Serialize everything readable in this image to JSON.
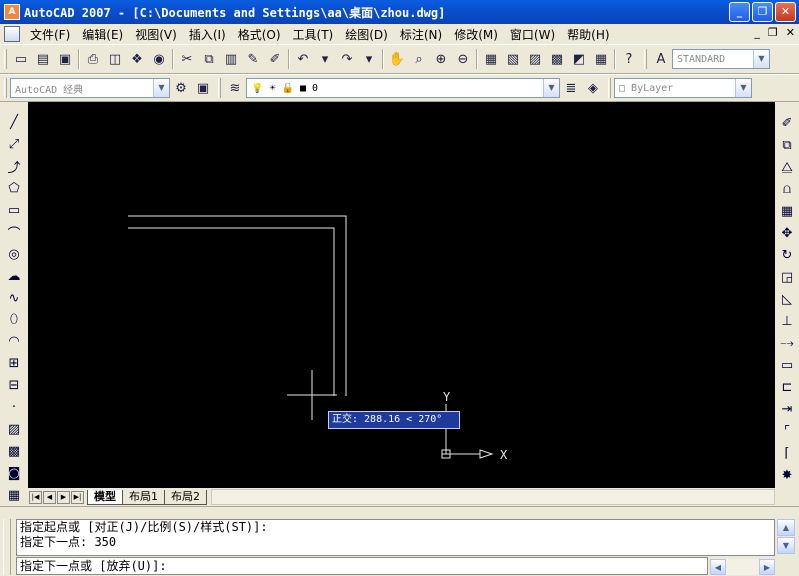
{
  "window": {
    "title": "AutoCAD 2007 - [C:\\Documents and Settings\\aa\\桌面\\zhou.dwg]",
    "app_icon": "autocad-icon"
  },
  "menu": {
    "items": [
      {
        "label": "文件(F)"
      },
      {
        "label": "编辑(E)"
      },
      {
        "label": "视图(V)"
      },
      {
        "label": "插入(I)"
      },
      {
        "label": "格式(O)"
      },
      {
        "label": "工具(T)"
      },
      {
        "label": "绘图(D)"
      },
      {
        "label": "标注(N)"
      },
      {
        "label": "修改(M)"
      },
      {
        "label": "窗口(W)"
      },
      {
        "label": "帮助(H)"
      }
    ]
  },
  "toolbar": {
    "text_style": "STANDARD",
    "workspace": "AutoCAD 经典",
    "layer": "0",
    "color": "ByLayer"
  },
  "drawing": {
    "ortho_tooltip": "正交: 288.16 < 270°",
    "ucs_y": "Y",
    "ucs_x": "X"
  },
  "layout_tabs": [
    {
      "label": "模型",
      "active": true
    },
    {
      "label": "布局1"
    },
    {
      "label": "布局2"
    }
  ],
  "command": {
    "history": [
      "指定起点或 [对正(J)/比例(S)/样式(ST)]:",
      "指定下一点: 350"
    ],
    "prompt": "指定下一点或 [放弃(U)]:"
  },
  "colors": {
    "titlebar": "#0a4fd0",
    "canvas": "#000000",
    "tooltip_bg": "#1d3a9c",
    "chrome": "#ece9d8"
  }
}
